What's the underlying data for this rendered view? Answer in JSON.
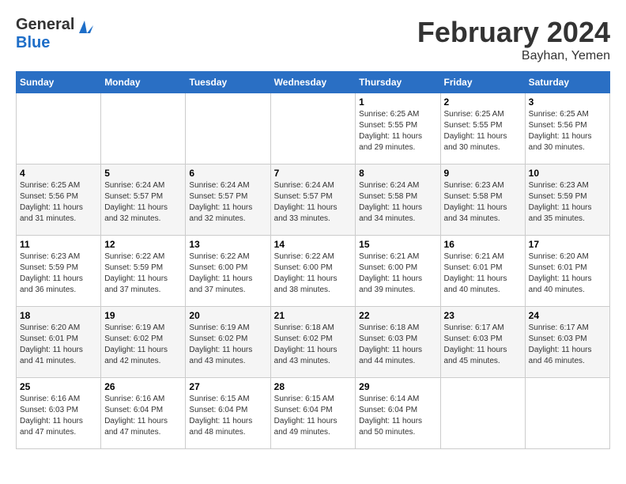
{
  "header": {
    "logo_general": "General",
    "logo_blue": "Blue",
    "month_year": "February 2024",
    "location": "Bayhan, Yemen"
  },
  "days_of_week": [
    "Sunday",
    "Monday",
    "Tuesday",
    "Wednesday",
    "Thursday",
    "Friday",
    "Saturday"
  ],
  "weeks": [
    [
      {
        "day": "",
        "info": ""
      },
      {
        "day": "",
        "info": ""
      },
      {
        "day": "",
        "info": ""
      },
      {
        "day": "",
        "info": ""
      },
      {
        "day": "1",
        "info": "Sunrise: 6:25 AM\nSunset: 5:55 PM\nDaylight: 11 hours and 29 minutes."
      },
      {
        "day": "2",
        "info": "Sunrise: 6:25 AM\nSunset: 5:55 PM\nDaylight: 11 hours and 30 minutes."
      },
      {
        "day": "3",
        "info": "Sunrise: 6:25 AM\nSunset: 5:56 PM\nDaylight: 11 hours and 30 minutes."
      }
    ],
    [
      {
        "day": "4",
        "info": "Sunrise: 6:25 AM\nSunset: 5:56 PM\nDaylight: 11 hours and 31 minutes."
      },
      {
        "day": "5",
        "info": "Sunrise: 6:24 AM\nSunset: 5:57 PM\nDaylight: 11 hours and 32 minutes."
      },
      {
        "day": "6",
        "info": "Sunrise: 6:24 AM\nSunset: 5:57 PM\nDaylight: 11 hours and 32 minutes."
      },
      {
        "day": "7",
        "info": "Sunrise: 6:24 AM\nSunset: 5:57 PM\nDaylight: 11 hours and 33 minutes."
      },
      {
        "day": "8",
        "info": "Sunrise: 6:24 AM\nSunset: 5:58 PM\nDaylight: 11 hours and 34 minutes."
      },
      {
        "day": "9",
        "info": "Sunrise: 6:23 AM\nSunset: 5:58 PM\nDaylight: 11 hours and 34 minutes."
      },
      {
        "day": "10",
        "info": "Sunrise: 6:23 AM\nSunset: 5:59 PM\nDaylight: 11 hours and 35 minutes."
      }
    ],
    [
      {
        "day": "11",
        "info": "Sunrise: 6:23 AM\nSunset: 5:59 PM\nDaylight: 11 hours and 36 minutes."
      },
      {
        "day": "12",
        "info": "Sunrise: 6:22 AM\nSunset: 5:59 PM\nDaylight: 11 hours and 37 minutes."
      },
      {
        "day": "13",
        "info": "Sunrise: 6:22 AM\nSunset: 6:00 PM\nDaylight: 11 hours and 37 minutes."
      },
      {
        "day": "14",
        "info": "Sunrise: 6:22 AM\nSunset: 6:00 PM\nDaylight: 11 hours and 38 minutes."
      },
      {
        "day": "15",
        "info": "Sunrise: 6:21 AM\nSunset: 6:00 PM\nDaylight: 11 hours and 39 minutes."
      },
      {
        "day": "16",
        "info": "Sunrise: 6:21 AM\nSunset: 6:01 PM\nDaylight: 11 hours and 40 minutes."
      },
      {
        "day": "17",
        "info": "Sunrise: 6:20 AM\nSunset: 6:01 PM\nDaylight: 11 hours and 40 minutes."
      }
    ],
    [
      {
        "day": "18",
        "info": "Sunrise: 6:20 AM\nSunset: 6:01 PM\nDaylight: 11 hours and 41 minutes."
      },
      {
        "day": "19",
        "info": "Sunrise: 6:19 AM\nSunset: 6:02 PM\nDaylight: 11 hours and 42 minutes."
      },
      {
        "day": "20",
        "info": "Sunrise: 6:19 AM\nSunset: 6:02 PM\nDaylight: 11 hours and 43 minutes."
      },
      {
        "day": "21",
        "info": "Sunrise: 6:18 AM\nSunset: 6:02 PM\nDaylight: 11 hours and 43 minutes."
      },
      {
        "day": "22",
        "info": "Sunrise: 6:18 AM\nSunset: 6:03 PM\nDaylight: 11 hours and 44 minutes."
      },
      {
        "day": "23",
        "info": "Sunrise: 6:17 AM\nSunset: 6:03 PM\nDaylight: 11 hours and 45 minutes."
      },
      {
        "day": "24",
        "info": "Sunrise: 6:17 AM\nSunset: 6:03 PM\nDaylight: 11 hours and 46 minutes."
      }
    ],
    [
      {
        "day": "25",
        "info": "Sunrise: 6:16 AM\nSunset: 6:03 PM\nDaylight: 11 hours and 47 minutes."
      },
      {
        "day": "26",
        "info": "Sunrise: 6:16 AM\nSunset: 6:04 PM\nDaylight: 11 hours and 47 minutes."
      },
      {
        "day": "27",
        "info": "Sunrise: 6:15 AM\nSunset: 6:04 PM\nDaylight: 11 hours and 48 minutes."
      },
      {
        "day": "28",
        "info": "Sunrise: 6:15 AM\nSunset: 6:04 PM\nDaylight: 11 hours and 49 minutes."
      },
      {
        "day": "29",
        "info": "Sunrise: 6:14 AM\nSunset: 6:04 PM\nDaylight: 11 hours and 50 minutes."
      },
      {
        "day": "",
        "info": ""
      },
      {
        "day": "",
        "info": ""
      }
    ]
  ]
}
